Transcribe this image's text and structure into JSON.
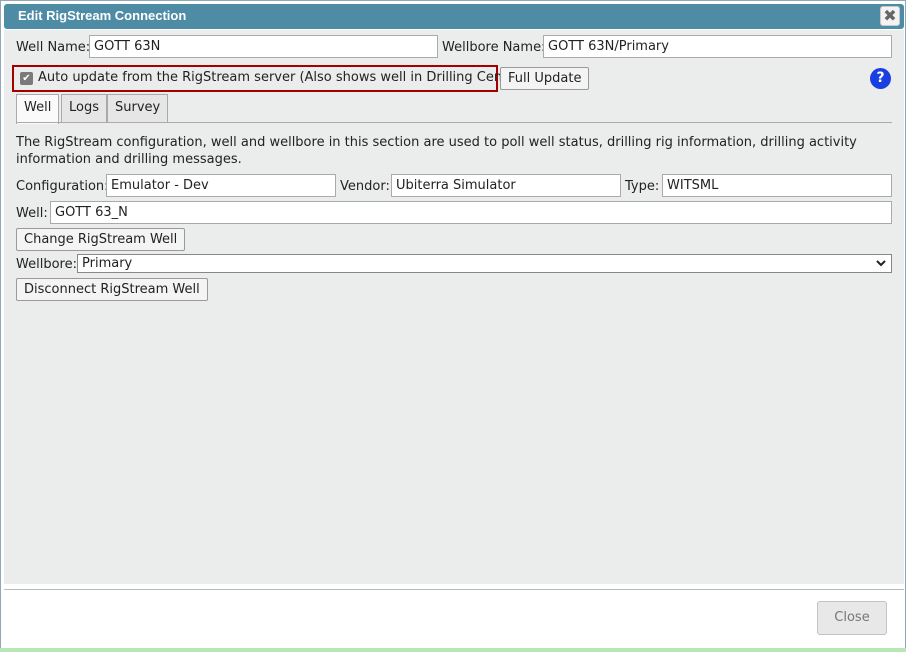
{
  "dialog": {
    "title": "Edit RigStream Connection",
    "close_icon": "close-icon",
    "close_glyph": "✖"
  },
  "header_fields": {
    "well_name_label": "Well Name:",
    "well_name_value": "GOTT 63N",
    "wellbore_name_label": "Wellbore Name:",
    "wellbore_name_value": "GOTT 63N/Primary"
  },
  "auto_update": {
    "checked": true,
    "label": "Auto update from the RigStream server (Also shows well in Drilling Center)",
    "full_update_label": "Full Update",
    "help_glyph": "?"
  },
  "tabs": [
    {
      "label": "Well",
      "active": true
    },
    {
      "label": "Logs",
      "active": false
    },
    {
      "label": "Survey",
      "active": false
    }
  ],
  "well_tab": {
    "description": "The RigStream configuration, well and wellbore in this section are used to poll well status, drilling rig information, drilling activity information and drilling messages.",
    "configuration_label": "Configuration:",
    "configuration_value": "Emulator - Dev",
    "vendor_label": "Vendor:",
    "vendor_value": "Ubiterra Simulator",
    "type_label": "Type:",
    "type_value": "WITSML",
    "well_label": "Well:",
    "well_value": "GOTT 63_N",
    "change_well_button": "Change RigStream Well",
    "wellbore_label": "Wellbore:",
    "wellbore_value": "Primary",
    "disconnect_button": "Disconnect RigStream Well"
  },
  "footer": {
    "close_label": "Close"
  },
  "colors": {
    "titlebar": "#4e8ca6",
    "highlight_border": "#a40000",
    "help_icon": "#1a3fe0",
    "panel_bg": "#ebecec"
  }
}
